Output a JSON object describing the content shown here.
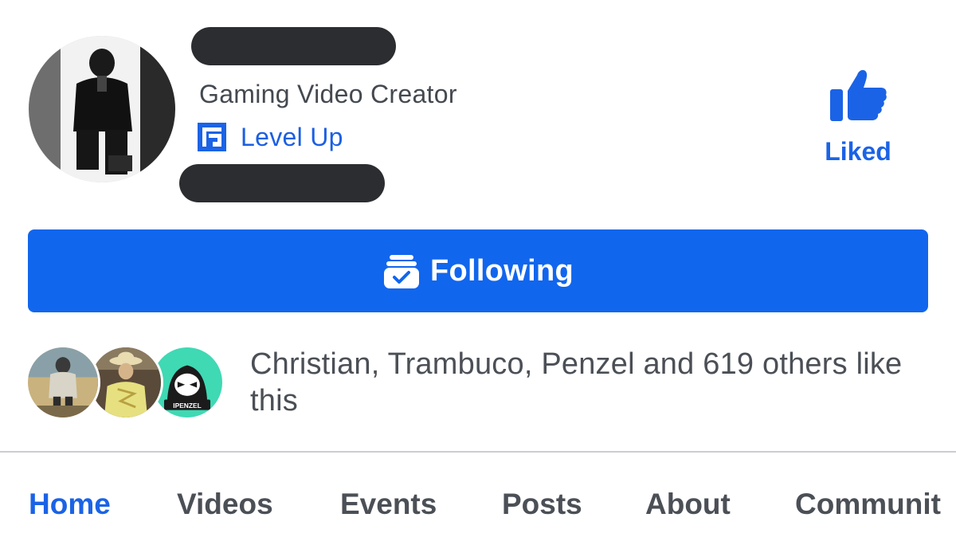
{
  "page": {
    "category": "Gaming Video Creator",
    "program_badge": "Level Up",
    "like_button_label": "Liked",
    "follow_button_label": "Following",
    "likes_summary": "Christian, Trambuco, Penzel and 619 others like this"
  },
  "friends": [
    {
      "icon": "friend-avatar-1"
    },
    {
      "icon": "friend-avatar-2"
    },
    {
      "icon": "friend-avatar-3",
      "badge_text": "IPENZEL"
    }
  ],
  "tabs": [
    {
      "label": "Home",
      "active": true
    },
    {
      "label": "Videos"
    },
    {
      "label": "Events"
    },
    {
      "label": "Posts"
    },
    {
      "label": "About"
    },
    {
      "label": "Communit"
    }
  ],
  "colors": {
    "accent": "#1166ee",
    "link": "#1b63e6",
    "text_secondary": "#4b4f56",
    "redaction": "#2b2d30"
  }
}
